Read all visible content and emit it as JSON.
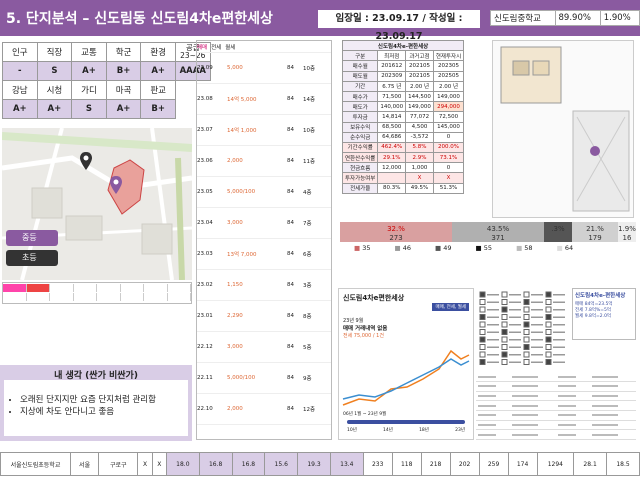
{
  "header": {
    "title": "5. 단지분석 – 신도림동 신도림4차e편한세상",
    "dates": "임장일 : 23.09.17 / 작성일 : 23.09.17"
  },
  "school": {
    "name": "신도림중학교",
    "v1": "89.90%",
    "v2": "1.90%"
  },
  "scores": {
    "row1": [
      "인구",
      "직장",
      "교통",
      "학군",
      "환경",
      "공급\n23~26"
    ],
    "row2": [
      "-",
      "S",
      "A+",
      "B+",
      "A+",
      "AAAA"
    ],
    "row3": [
      "강남",
      "시청",
      "가디",
      "마곡",
      "판교",
      ""
    ],
    "row4": [
      "A+",
      "A+",
      "S",
      "A+",
      "B+",
      ""
    ]
  },
  "map": {
    "legend": [
      "중등",
      "초등"
    ]
  },
  "notes": {
    "title": "내 생각 (싼가 비싼가)",
    "items": [
      "오래된 단지지만 요즘 단지처럼 관리함",
      "지상에 차도 안다니고 좋음"
    ]
  },
  "trades": {
    "filters": [
      "매매",
      "전세",
      "월세"
    ],
    "rows": [
      {
        "date": "23.09",
        "price": "5,000",
        "area": "84",
        "floor": "10층"
      },
      {
        "date": "23.08",
        "price": "14억 5,000",
        "area": "84",
        "floor": "14층"
      },
      {
        "date": "23.07",
        "price": "14억 1,000",
        "area": "84",
        "floor": "10층"
      },
      {
        "date": "23.06",
        "price": "2,000",
        "area": "84",
        "floor": "11층"
      },
      {
        "date": "23.05",
        "price": "5,000/100",
        "area": "84",
        "floor": "4층"
      },
      {
        "date": "23.04",
        "price": "3,000",
        "area": "84",
        "floor": "7층"
      },
      {
        "date": "23.03",
        "price": "13억 7,000",
        "area": "84",
        "floor": "6층"
      },
      {
        "date": "23.02",
        "price": "1,150",
        "area": "84",
        "floor": "3층"
      },
      {
        "date": "23.01",
        "price": "2,290",
        "area": "84",
        "floor": "8층"
      },
      {
        "date": "22.12",
        "price": "3,000",
        "area": "84",
        "floor": "5층"
      },
      {
        "date": "22.11",
        "price": "5,000/100",
        "area": "84",
        "floor": "9층"
      },
      {
        "date": "22.10",
        "price": "2,000",
        "area": "84",
        "floor": "12층"
      }
    ]
  },
  "summary": {
    "title": "신도림4차e-편한세상",
    "cols": [
      "구분",
      "최저점",
      "과거고점",
      "현재투자시"
    ],
    "rows": [
      [
        "매수월",
        "201612",
        "202105",
        "202305"
      ],
      [
        "매도월",
        "202309",
        "202105",
        "202505"
      ],
      [
        "기간",
        "6.75 년",
        "2.00 년",
        "2.00 년"
      ],
      [
        "매수가",
        "71,500",
        "144,500",
        "149,000"
      ],
      [
        "매도가",
        "140,000",
        "149,000",
        "294,000"
      ],
      [
        "투자금",
        "14,814",
        "77,072",
        "72,500"
      ],
      [
        "보유수익",
        "68,500",
        "4,500",
        "145,000"
      ],
      [
        "순수익금",
        "64,686",
        "-3,572",
        "0"
      ],
      [
        "기간수익률",
        "462.4%",
        "5.8%",
        "200.0%"
      ],
      [
        "연환산수익률",
        "29.1%",
        "2.9%",
        "73.1%"
      ],
      [
        "현금흐름",
        "12,000",
        "1,000",
        "0"
      ],
      [
        "투자가능여부",
        "",
        "X",
        "X"
      ],
      [
        "전세가율",
        "80.3%",
        "49.5%",
        "51.3%"
      ]
    ]
  },
  "chart_bars": {
    "labels": [
      "32.%",
      "43.5%",
      ".3%",
      "21.%",
      "1.9%"
    ],
    "sub": [
      "273",
      "371",
      "",
      "179",
      "16"
    ],
    "legend": [
      "35",
      "46",
      "49",
      "55",
      "58",
      "64"
    ]
  },
  "phone": {
    "title": "신도림4차e편한세상",
    "tabs": [
      "매매, 전세, 월세"
    ],
    "date": "23년 9월",
    "trade": "매매 거래내역 없음",
    "rent": "전세 75,000 / 1건",
    "axis": [
      "06년 1월 ~ 23년 9월",
      "10년",
      "14년",
      "18년",
      "23년"
    ]
  },
  "building": {
    "title": "신도림4차e-편한세상",
    "lines": [
      "매매 84억=23.5억",
      "전세 7.8억%=5억",
      "월세 9.8억=2.0억"
    ]
  },
  "bottom": {
    "headers": [
      "",
      "",
      "학생수",
      "학부모",
      "국제",
      "3학년\n학생",
      "3학년\n학생",
      "1학년",
      "2학년",
      "3학년",
      "1학년",
      "2학년",
      "3학년",
      "",
      "",
      "",
      "",
      "",
      "",
      "",
      "",
      "",
      "",
      ""
    ],
    "row": [
      "서울신도림초등학교",
      "서울",
      "구로구",
      "X",
      "X",
      "18.0",
      "16.8",
      "16.8",
      "15.6",
      "19.3",
      "13.4",
      "233",
      "118",
      "218",
      "202",
      "259",
      "174",
      "1294",
      "28.1",
      "18.5"
    ]
  }
}
